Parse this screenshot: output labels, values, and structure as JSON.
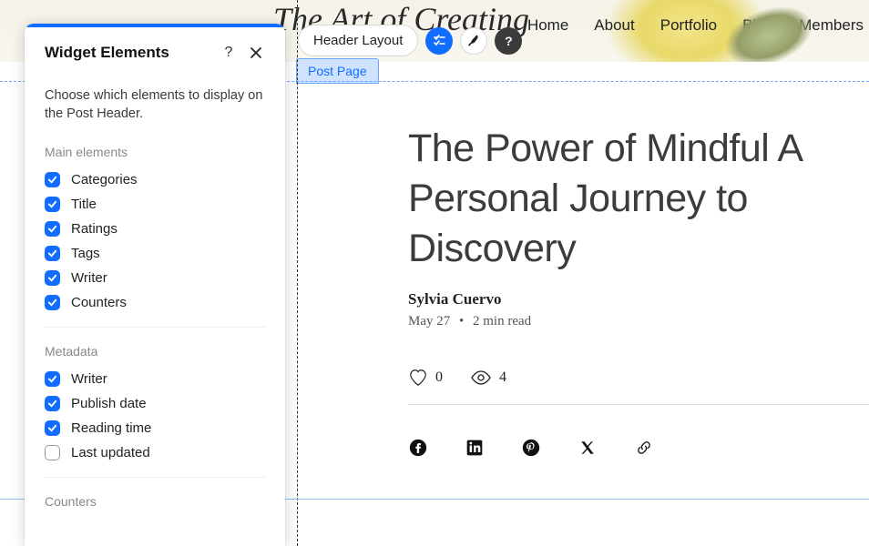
{
  "site": {
    "title": "The Art of Creating",
    "nav": [
      "Home",
      "About",
      "Portfolio",
      "Blog",
      "Members"
    ]
  },
  "toolbar": {
    "label": "Header Layout"
  },
  "editor": {
    "postpage_label": "Post Page"
  },
  "article": {
    "title": "The Power of Mindful A Personal Journey to Discovery",
    "author": "Sylvia Cuervo",
    "date": "May 27",
    "read_time": "2 min read",
    "likes": "0",
    "views": "4"
  },
  "panel": {
    "title": "Widget Elements",
    "description": "Choose which elements to display on the Post Header.",
    "sections": [
      {
        "title": "Main elements",
        "items": [
          {
            "label": "Categories",
            "checked": true
          },
          {
            "label": "Title",
            "checked": true
          },
          {
            "label": "Ratings",
            "checked": true
          },
          {
            "label": "Tags",
            "checked": true
          },
          {
            "label": "Writer",
            "checked": true
          },
          {
            "label": "Counters",
            "checked": true
          }
        ]
      },
      {
        "title": "Metadata",
        "items": [
          {
            "label": "Writer",
            "checked": true
          },
          {
            "label": "Publish date",
            "checked": true
          },
          {
            "label": "Reading time",
            "checked": true
          },
          {
            "label": "Last updated",
            "checked": false
          }
        ]
      },
      {
        "title": "Counters",
        "items": []
      }
    ]
  },
  "colors": {
    "accent": "#116dff"
  }
}
